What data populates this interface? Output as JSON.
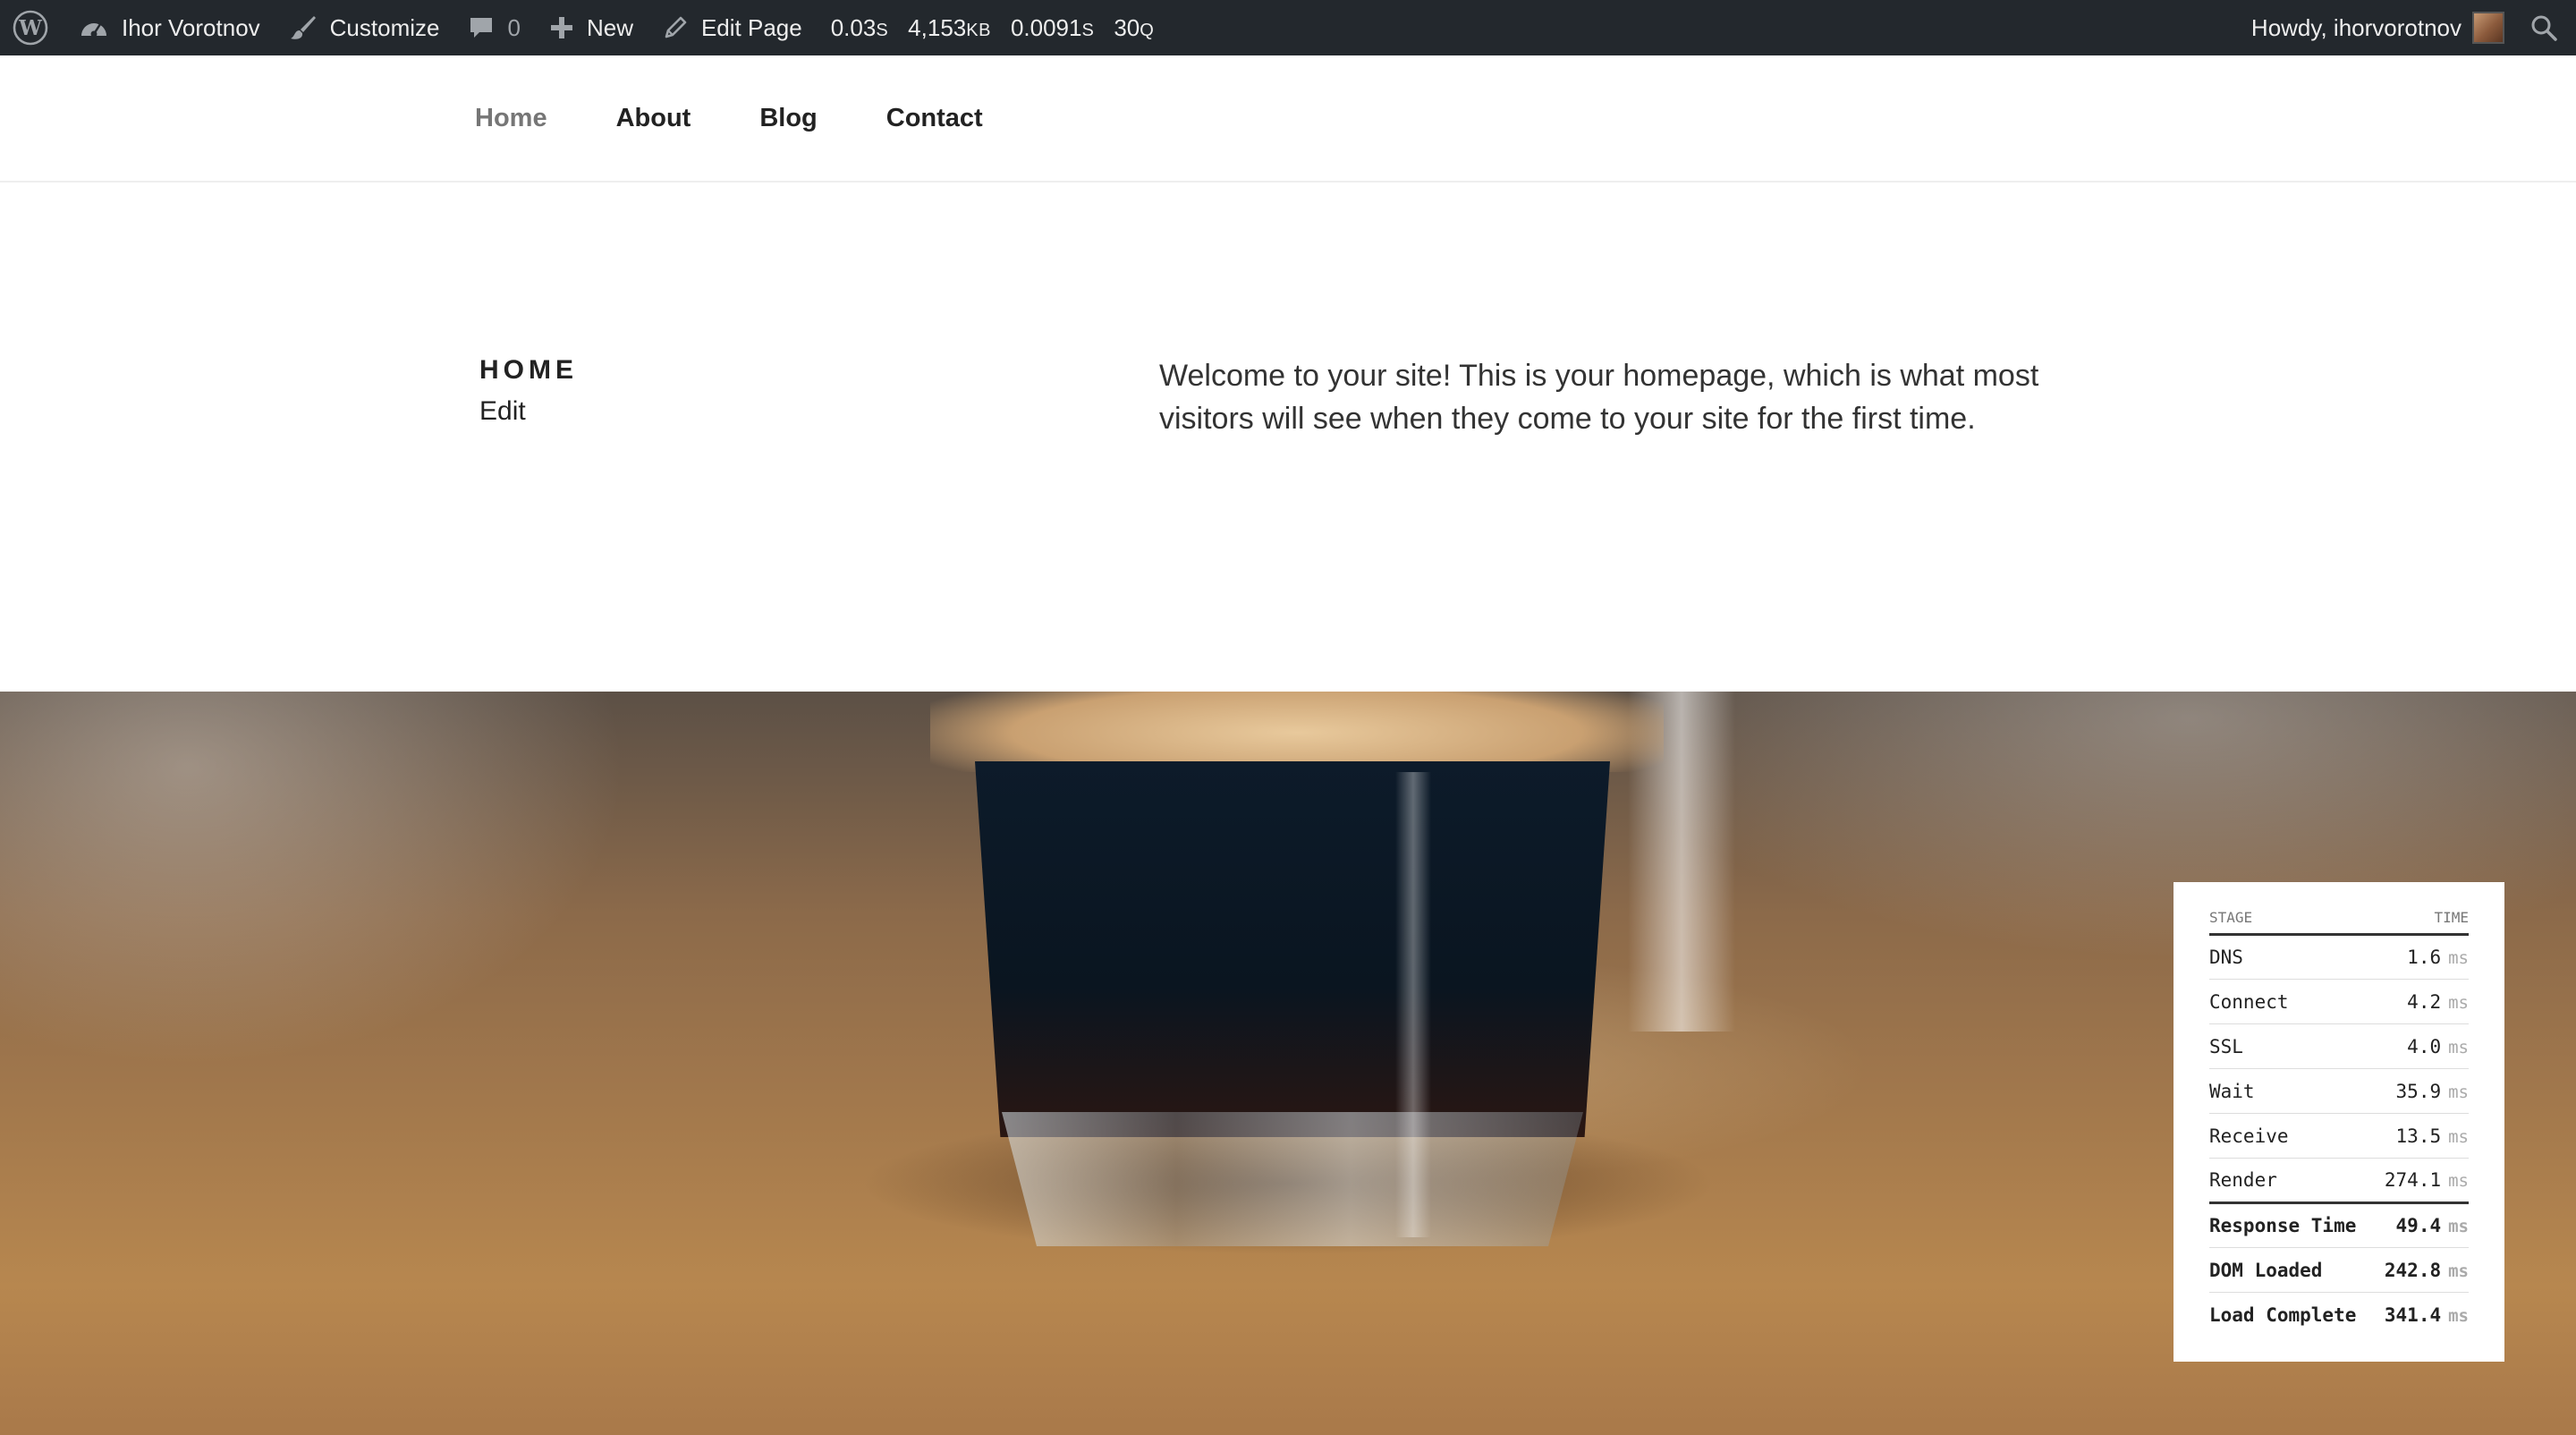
{
  "admin_bar": {
    "site_name": "Ihor Vorotnov",
    "customize": "Customize",
    "comments_count": "0",
    "new_label": "New",
    "edit_page": "Edit Page",
    "stats": [
      {
        "value": "0.03",
        "unit": "S"
      },
      {
        "value": "4,153",
        "unit": "KB"
      },
      {
        "value": "0.0091",
        "unit": "S"
      },
      {
        "value": "30",
        "unit": "Q"
      }
    ],
    "howdy": "Howdy, ihorvorotnov",
    "colors": {
      "background": "#23282d",
      "text": "#eeeeee"
    }
  },
  "nav": {
    "items": [
      {
        "label": "Home",
        "current": true
      },
      {
        "label": "About",
        "current": false
      },
      {
        "label": "Blog",
        "current": false
      },
      {
        "label": "Contact",
        "current": false
      }
    ]
  },
  "page": {
    "title": "HOME",
    "edit_link": "Edit",
    "content": "Welcome to your site! This is your homepage, which is what most visitors will see when they come to your site for the first time."
  },
  "timing": {
    "headers": {
      "stage": "STAGE",
      "time": "TIME"
    },
    "unit": "ms",
    "rows": [
      {
        "stage": "DNS",
        "time": "1.6"
      },
      {
        "stage": "Connect",
        "time": "4.2"
      },
      {
        "stage": "SSL",
        "time": "4.0"
      },
      {
        "stage": "Wait",
        "time": "35.9"
      },
      {
        "stage": "Receive",
        "time": "13.5"
      },
      {
        "stage": "Render",
        "time": "274.1"
      }
    ],
    "totals": [
      {
        "stage": "Response Time",
        "time": "49.4"
      },
      {
        "stage": "DOM Loaded",
        "time": "242.8"
      },
      {
        "stage": "Load Complete",
        "time": "341.4"
      }
    ]
  },
  "icons": [
    "wordpress-logo-icon",
    "dashboard-icon",
    "paintbrush-icon",
    "comment-icon",
    "plus-icon",
    "pencil-icon",
    "search-icon"
  ]
}
